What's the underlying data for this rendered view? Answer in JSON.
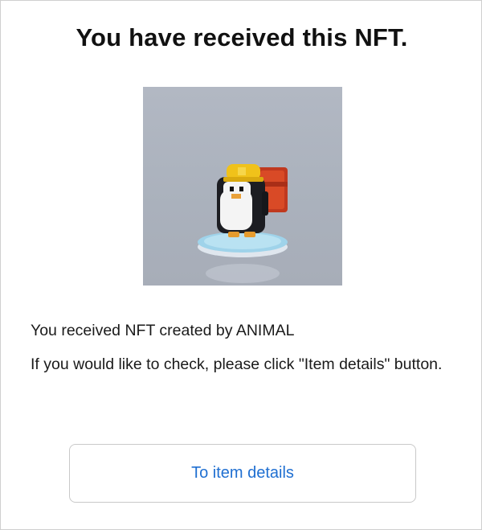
{
  "dialog": {
    "title": "You have received this NFT.",
    "image_subject": "voxel-penguin-icon",
    "message_line1": "You received NFT created by ANIMAL",
    "message_line2": "If you would like to check, please click \"Item details\" button.",
    "button_label": "To item details"
  },
  "colors": {
    "button_text": "#1f6fd1",
    "image_background": "#aeb4bf"
  }
}
